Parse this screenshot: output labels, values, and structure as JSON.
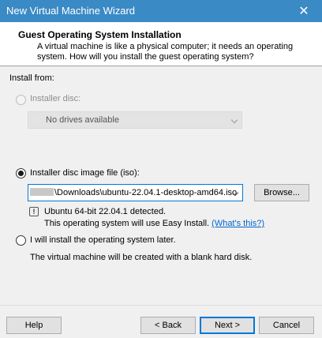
{
  "window": {
    "title": "New Virtual Machine Wizard",
    "close_glyph": "✕"
  },
  "header": {
    "title": "Guest Operating System Installation",
    "description": "A virtual machine is like a physical computer; it needs an operating system. How will you install the guest operating system?"
  },
  "install_from_label": "Install from:",
  "installer_disc": {
    "label": "Installer disc:",
    "selected": "No drives available",
    "enabled": false,
    "checked": false
  },
  "iso_option": {
    "label": "Installer disc image file (iso):",
    "checked": true,
    "path": "\\Downloads\\ubuntu-22.04.1-desktop-amd64.iso",
    "browse_label": "Browse...",
    "detected_text": "Ubuntu 64-bit 22.04.1 detected.",
    "easy_install_text": "This operating system will use Easy Install.",
    "whats_this_link": "(What's this?)"
  },
  "later_option": {
    "label": "I will install the operating system later.",
    "checked": false,
    "description": "The virtual machine will be created with a blank hard disk."
  },
  "footer": {
    "help_label": "Help",
    "back_label": "< Back",
    "next_label": "Next >",
    "cancel_label": "Cancel"
  },
  "colors": {
    "titlebar": "#3a8ac5",
    "accent": "#0078d7",
    "link": "#0066cc"
  }
}
